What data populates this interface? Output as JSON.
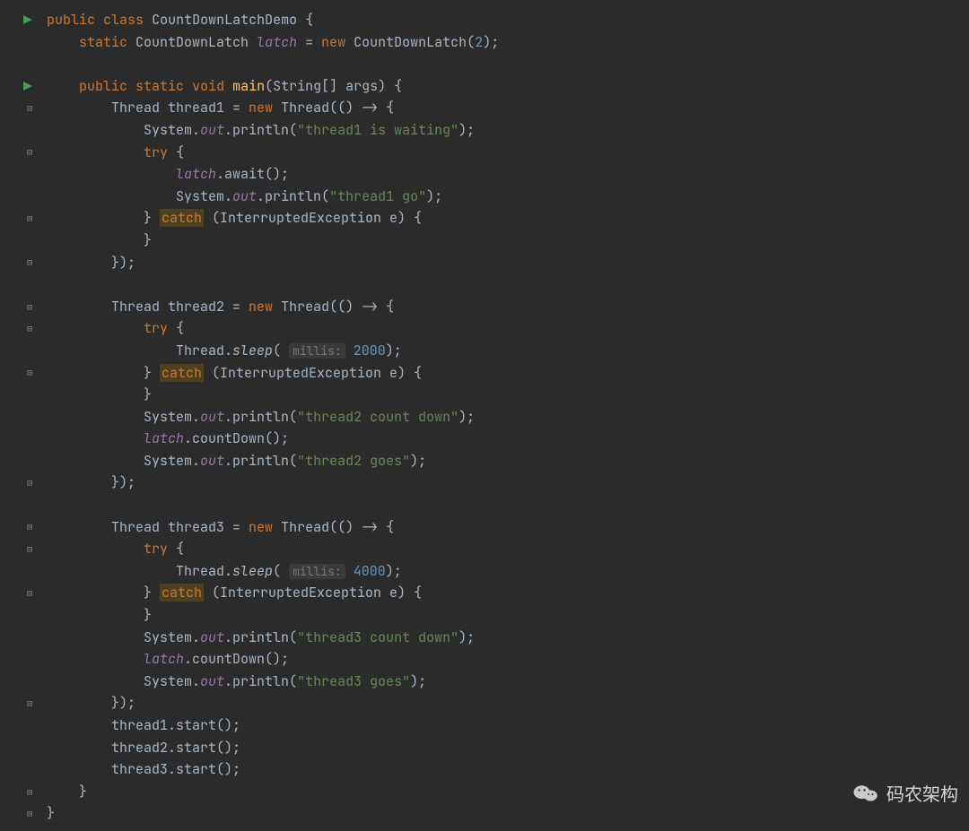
{
  "colors": {
    "background": "#2b2b2b",
    "foreground": "#a9b7c6",
    "keyword": "#cc7832",
    "string": "#6a8759",
    "number": "#6897bb",
    "function": "#ffc66d",
    "static_field": "#9876aa",
    "hint_bg": "#3a3a3a",
    "catch_highlight_bg": "#4d4021"
  },
  "gutter": [
    {
      "marker": "run"
    },
    {
      "marker": ""
    },
    {
      "marker": ""
    },
    {
      "marker": "run"
    },
    {
      "marker": "fold-open"
    },
    {
      "marker": ""
    },
    {
      "marker": "fold-open"
    },
    {
      "marker": ""
    },
    {
      "marker": ""
    },
    {
      "marker": "fold-close"
    },
    {
      "marker": ""
    },
    {
      "marker": "fold-close"
    },
    {
      "marker": ""
    },
    {
      "marker": "fold-open"
    },
    {
      "marker": "fold-open"
    },
    {
      "marker": ""
    },
    {
      "marker": "fold-close"
    },
    {
      "marker": ""
    },
    {
      "marker": ""
    },
    {
      "marker": ""
    },
    {
      "marker": ""
    },
    {
      "marker": "fold-close"
    },
    {
      "marker": ""
    },
    {
      "marker": "fold-open"
    },
    {
      "marker": "fold-open"
    },
    {
      "marker": ""
    },
    {
      "marker": "fold-close"
    },
    {
      "marker": ""
    },
    {
      "marker": ""
    },
    {
      "marker": ""
    },
    {
      "marker": ""
    },
    {
      "marker": "fold-close"
    },
    {
      "marker": ""
    },
    {
      "marker": ""
    },
    {
      "marker": ""
    },
    {
      "marker": "fold-close"
    },
    {
      "marker": "fold-close"
    }
  ],
  "code": [
    {
      "indent": 0,
      "tokens": [
        [
          "kw",
          "public"
        ],
        [
          "sp",
          " "
        ],
        [
          "kw",
          "class"
        ],
        [
          "sp",
          " "
        ],
        [
          "sym",
          "CountDownLatchDemo"
        ],
        [
          "sp",
          " "
        ],
        [
          "sym",
          "{"
        ]
      ]
    },
    {
      "indent": 1,
      "tokens": [
        [
          "kw",
          "static"
        ],
        [
          "sp",
          " "
        ],
        [
          "sym",
          "CountDownLatch"
        ],
        [
          "sp",
          " "
        ],
        [
          "var-static",
          "latch"
        ],
        [
          "sp",
          " "
        ],
        [
          "sym",
          "="
        ],
        [
          "sp",
          " "
        ],
        [
          "kw",
          "new"
        ],
        [
          "sp",
          " "
        ],
        [
          "sym",
          "CountDownLatch("
        ],
        [
          "num",
          "2"
        ],
        [
          "sym",
          ");"
        ]
      ]
    },
    {
      "indent": 0,
      "tokens": []
    },
    {
      "indent": 1,
      "tokens": [
        [
          "kw",
          "public"
        ],
        [
          "sp",
          " "
        ],
        [
          "kw",
          "static"
        ],
        [
          "sp",
          " "
        ],
        [
          "kw",
          "void"
        ],
        [
          "sp",
          " "
        ],
        [
          "fn",
          "main"
        ],
        [
          "sym",
          "(String[] args) {"
        ]
      ]
    },
    {
      "indent": 2,
      "tokens": [
        [
          "sym",
          "Thread thread1 = "
        ],
        [
          "kw",
          "new"
        ],
        [
          "sp",
          " "
        ],
        [
          "sym",
          "Thread(() -> {"
        ]
      ]
    },
    {
      "indent": 3,
      "tokens": [
        [
          "sym",
          "System."
        ],
        [
          "var-static",
          "out"
        ],
        [
          "sym",
          ".println("
        ],
        [
          "str",
          "\"thread1 is waiting\""
        ],
        [
          "sym",
          ");"
        ]
      ]
    },
    {
      "indent": 3,
      "tokens": [
        [
          "kw",
          "try"
        ],
        [
          "sp",
          " "
        ],
        [
          "sym",
          "{"
        ]
      ]
    },
    {
      "indent": 4,
      "tokens": [
        [
          "var-static",
          "latch"
        ],
        [
          "sym",
          ".await();"
        ]
      ]
    },
    {
      "indent": 4,
      "tokens": [
        [
          "sym",
          "System."
        ],
        [
          "var-static",
          "out"
        ],
        [
          "sym",
          ".println("
        ],
        [
          "str",
          "\"thread1 go\""
        ],
        [
          "sym",
          ");"
        ]
      ]
    },
    {
      "indent": 3,
      "tokens": [
        [
          "sym",
          "} "
        ],
        [
          "catch-hl",
          "catch"
        ],
        [
          "sym",
          " (InterruptedException e) {"
        ]
      ]
    },
    {
      "indent": 3,
      "tokens": [
        [
          "sym",
          "}"
        ]
      ]
    },
    {
      "indent": 2,
      "tokens": [
        [
          "sym",
          "});"
        ]
      ]
    },
    {
      "indent": 0,
      "tokens": []
    },
    {
      "indent": 2,
      "tokens": [
        [
          "sym",
          "Thread thread2 = "
        ],
        [
          "kw",
          "new"
        ],
        [
          "sp",
          " "
        ],
        [
          "sym",
          "Thread(() -> {"
        ]
      ]
    },
    {
      "indent": 3,
      "tokens": [
        [
          "kw",
          "try"
        ],
        [
          "sp",
          " "
        ],
        [
          "sym",
          "{"
        ]
      ]
    },
    {
      "indent": 4,
      "tokens": [
        [
          "sym",
          "Thread."
        ],
        [
          "static-meth",
          "sleep"
        ],
        [
          "sym",
          "( "
        ],
        [
          "hint",
          "millis:"
        ],
        [
          "sp",
          " "
        ],
        [
          "num",
          "2000"
        ],
        [
          "sym",
          ");"
        ]
      ]
    },
    {
      "indent": 3,
      "tokens": [
        [
          "sym",
          "} "
        ],
        [
          "catch-hl",
          "catch"
        ],
        [
          "sym",
          " (InterruptedException e) {"
        ]
      ]
    },
    {
      "indent": 3,
      "tokens": [
        [
          "sym",
          "}"
        ]
      ]
    },
    {
      "indent": 3,
      "tokens": [
        [
          "sym",
          "System."
        ],
        [
          "var-static",
          "out"
        ],
        [
          "sym",
          ".println("
        ],
        [
          "str",
          "\"thread2 count down\""
        ],
        [
          "sym",
          ");"
        ]
      ]
    },
    {
      "indent": 3,
      "tokens": [
        [
          "var-static",
          "latch"
        ],
        [
          "sym",
          ".countDown();"
        ]
      ]
    },
    {
      "indent": 3,
      "tokens": [
        [
          "sym",
          "System."
        ],
        [
          "var-static",
          "out"
        ],
        [
          "sym",
          ".println("
        ],
        [
          "str",
          "\"thread2 goes\""
        ],
        [
          "sym",
          ");"
        ]
      ]
    },
    {
      "indent": 2,
      "tokens": [
        [
          "sym",
          "});"
        ]
      ]
    },
    {
      "indent": 0,
      "tokens": []
    },
    {
      "indent": 2,
      "tokens": [
        [
          "sym",
          "Thread thread3 = "
        ],
        [
          "kw",
          "new"
        ],
        [
          "sp",
          " "
        ],
        [
          "sym",
          "Thread(() -> {"
        ]
      ]
    },
    {
      "indent": 3,
      "tokens": [
        [
          "kw",
          "try"
        ],
        [
          "sp",
          " "
        ],
        [
          "sym",
          "{"
        ]
      ]
    },
    {
      "indent": 4,
      "tokens": [
        [
          "sym",
          "Thread."
        ],
        [
          "static-meth",
          "sleep"
        ],
        [
          "sym",
          "( "
        ],
        [
          "hint",
          "millis:"
        ],
        [
          "sp",
          " "
        ],
        [
          "num",
          "4000"
        ],
        [
          "sym",
          ");"
        ]
      ]
    },
    {
      "indent": 3,
      "tokens": [
        [
          "sym",
          "} "
        ],
        [
          "catch-hl",
          "catch"
        ],
        [
          "sym",
          " (InterruptedException e) {"
        ]
      ]
    },
    {
      "indent": 3,
      "tokens": [
        [
          "sym",
          "}"
        ]
      ]
    },
    {
      "indent": 3,
      "tokens": [
        [
          "sym",
          "System."
        ],
        [
          "var-static",
          "out"
        ],
        [
          "sym",
          ".println("
        ],
        [
          "str",
          "\"thread3 count down\""
        ],
        [
          "sym",
          ");"
        ]
      ]
    },
    {
      "indent": 3,
      "tokens": [
        [
          "var-static",
          "latch"
        ],
        [
          "sym",
          ".countDown();"
        ]
      ]
    },
    {
      "indent": 3,
      "tokens": [
        [
          "sym",
          "System."
        ],
        [
          "var-static",
          "out"
        ],
        [
          "sym",
          ".println("
        ],
        [
          "str",
          "\"thread3 goes\""
        ],
        [
          "sym",
          ");"
        ]
      ]
    },
    {
      "indent": 2,
      "tokens": [
        [
          "sym",
          "});"
        ]
      ]
    },
    {
      "indent": 2,
      "tokens": [
        [
          "sym",
          "thread1.start();"
        ]
      ]
    },
    {
      "indent": 2,
      "tokens": [
        [
          "sym",
          "thread2.start();"
        ]
      ]
    },
    {
      "indent": 2,
      "tokens": [
        [
          "sym",
          "thread3.start();"
        ]
      ]
    },
    {
      "indent": 1,
      "tokens": [
        [
          "sym",
          "}"
        ]
      ]
    },
    {
      "indent": 0,
      "tokens": [
        [
          "sym",
          "}"
        ]
      ]
    }
  ],
  "watermark": {
    "text": "码农架构"
  }
}
